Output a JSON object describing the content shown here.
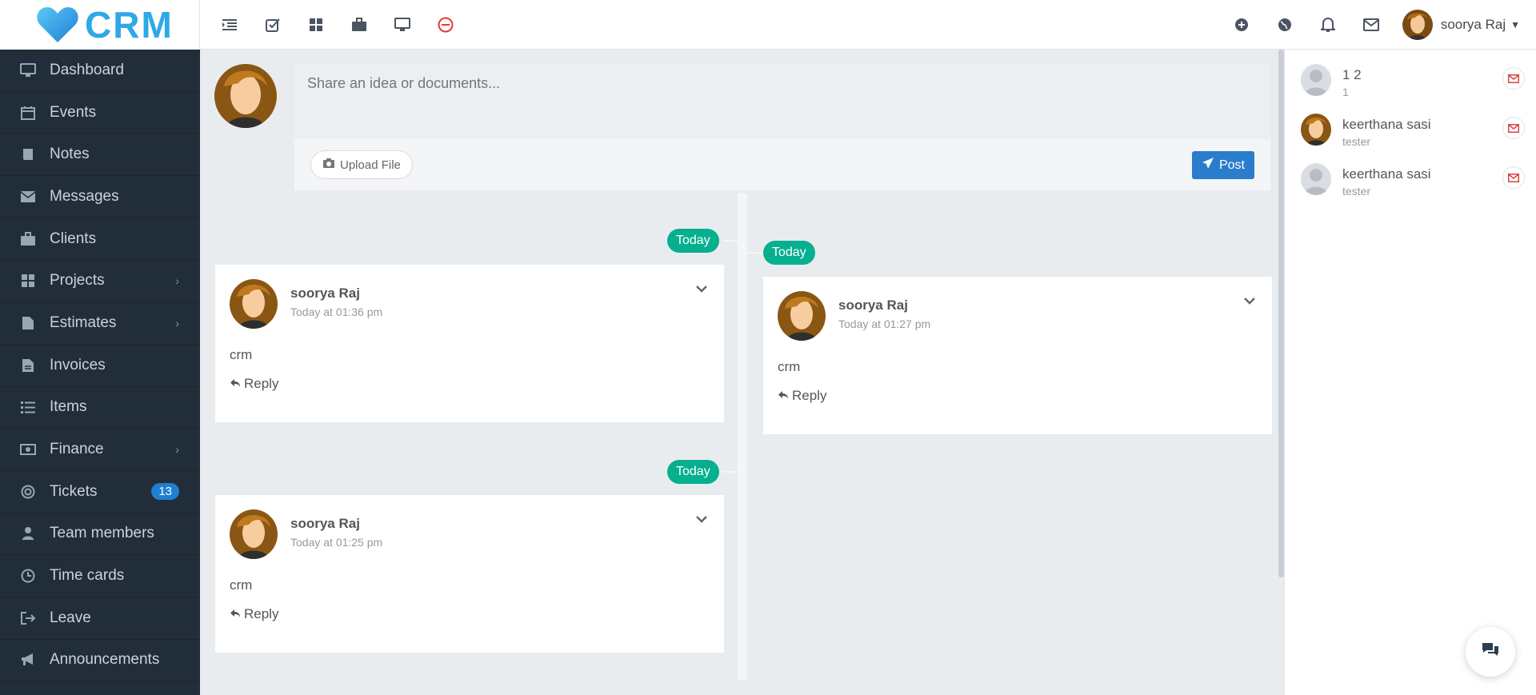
{
  "brand": {
    "name": "CRM",
    "color": "#2fa8e8"
  },
  "sidebar": {
    "items": [
      {
        "label": "Dashboard",
        "icon": "desktop-icon"
      },
      {
        "label": "Events",
        "icon": "calendar-icon"
      },
      {
        "label": "Notes",
        "icon": "book-icon"
      },
      {
        "label": "Messages",
        "icon": "envelope-icon"
      },
      {
        "label": "Clients",
        "icon": "briefcase-icon"
      },
      {
        "label": "Projects",
        "icon": "grid-icon",
        "has_submenu": true
      },
      {
        "label": "Estimates",
        "icon": "file-icon",
        "has_submenu": true
      },
      {
        "label": "Invoices",
        "icon": "file-text-icon"
      },
      {
        "label": "Items",
        "icon": "list-icon"
      },
      {
        "label": "Finance",
        "icon": "money-icon",
        "has_submenu": true
      },
      {
        "label": "Tickets",
        "icon": "lifebuoy-icon",
        "badge": "13"
      },
      {
        "label": "Team members",
        "icon": "user-icon"
      },
      {
        "label": "Time cards",
        "icon": "clock-icon"
      },
      {
        "label": "Leave",
        "icon": "sign-out-icon"
      },
      {
        "label": "Announcements",
        "icon": "bullhorn-icon"
      }
    ]
  },
  "topbar": {
    "left_icons": [
      "menu-toggle-icon",
      "check-square-icon",
      "grid-icon",
      "briefcase-icon",
      "desktop-icon",
      "stop-circle-icon"
    ],
    "right_icons": [
      "plus-circle-icon",
      "globe-icon",
      "bell-icon",
      "envelope-icon"
    ],
    "user_name": "soorya Raj"
  },
  "composer": {
    "placeholder": "Share an idea or documents...",
    "upload_label": "Upload File",
    "post_label": "Post"
  },
  "timeline": {
    "posts": [
      {
        "date_badge": "Today",
        "author": "soorya Raj",
        "time": "Today at 01:36 pm",
        "body": "crm",
        "reply_label": "Reply"
      },
      {
        "date_badge": "Today",
        "author": "soorya Raj",
        "time": "Today at 01:27 pm",
        "body": "crm",
        "reply_label": "Reply"
      },
      {
        "date_badge": "Today",
        "author": "soorya Raj",
        "time": "Today at 01:25 pm",
        "body": "crm",
        "reply_label": "Reply"
      }
    ]
  },
  "contacts": [
    {
      "name": "1 2",
      "sub": "1",
      "avatar": "default"
    },
    {
      "name": "keerthana sasi",
      "sub": "tester",
      "avatar": "photo"
    },
    {
      "name": "keerthana sasi",
      "sub": "tester",
      "avatar": "default"
    }
  ],
  "colors": {
    "sidebar_bg": "#222d3a",
    "accent_green": "#06b08f",
    "primary_blue": "#2a7ccc",
    "badge_blue": "#1f80d0"
  }
}
